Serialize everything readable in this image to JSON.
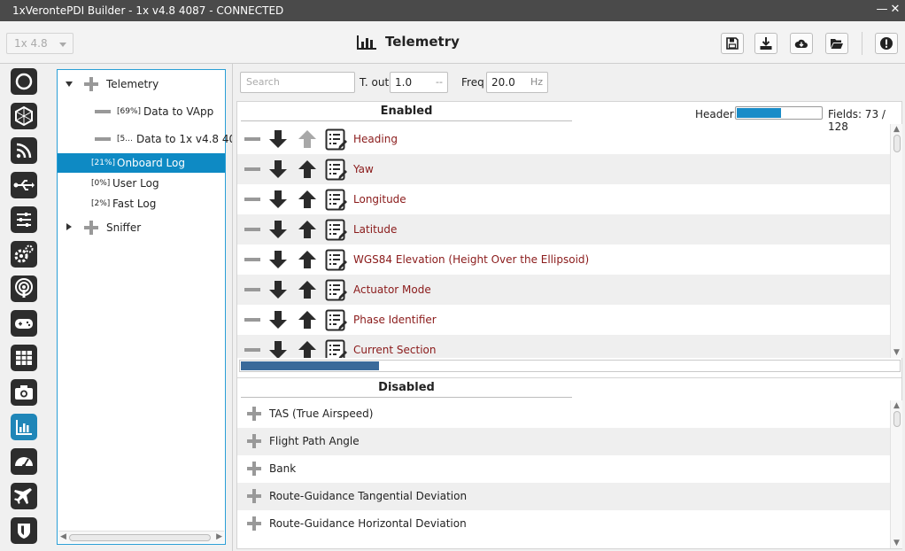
{
  "window": {
    "title": "1xVerontePDI Builder - 1x v4.8 4087 - CONNECTED",
    "minimize": "—",
    "close": "✕"
  },
  "toolbar": {
    "version_select": "1x 4.8",
    "page_title": "Telemetry",
    "buttons": [
      "save-icon",
      "download-icon",
      "cloud-download-icon",
      "open-folder-icon",
      "info-icon"
    ]
  },
  "sidebar": {
    "icons": [
      "power-icon",
      "hexagon-icon",
      "rss-icon",
      "usb-icon",
      "sliders-icon",
      "gears-icon",
      "podcast-icon",
      "gamepad-icon",
      "grid-icon",
      "camera-icon",
      "telemetry-icon",
      "dashboard-icon",
      "airplane-icon",
      "shield-icon"
    ],
    "active_index": 10,
    "active_color": "#1f86b8"
  },
  "tree": {
    "items": [
      {
        "label": "Telemetry",
        "pct": "",
        "kind": "group-open"
      },
      {
        "label": "Data to VApp",
        "pct": "[69%]",
        "kind": "leaf-dash"
      },
      {
        "label": "Data to 1x v4.8 40...",
        "pct": "[5...",
        "kind": "leaf-dash"
      },
      {
        "label": "Onboard Log",
        "pct": "[21%]",
        "kind": "leaf-selected"
      },
      {
        "label": "User Log",
        "pct": "[0%]",
        "kind": "leaf"
      },
      {
        "label": "Fast Log",
        "pct": "[2%]",
        "kind": "leaf"
      },
      {
        "label": "Sniffer",
        "pct": "",
        "kind": "group-closed"
      }
    ]
  },
  "filters": {
    "search_placeholder": "Search",
    "tout_label": "T. out",
    "tout_value": "1.0",
    "tout_unit": "--",
    "freq_label": "Freq",
    "freq_value": "20.0",
    "freq_unit": "Hz"
  },
  "enabled": {
    "title": "Enabled",
    "header_label": "Header:",
    "header_fill": 0.52,
    "fields_text": "Fields: 73 / 128",
    "progress_fill": 0.21,
    "items": [
      "Heading",
      "Yaw",
      "Longitude",
      "Latitude",
      "WGS84 Elevation (Height Over the Ellipsoid)",
      "Actuator Mode",
      "Phase Identifier",
      "Current Section"
    ]
  },
  "disabled": {
    "title": "Disabled",
    "items": [
      "TAS (True Airspeed)",
      "Flight Path Angle",
      "Bank",
      "Route-Guidance Tangential Deviation",
      "Route-Guidance Horizontal Deviation"
    ]
  }
}
